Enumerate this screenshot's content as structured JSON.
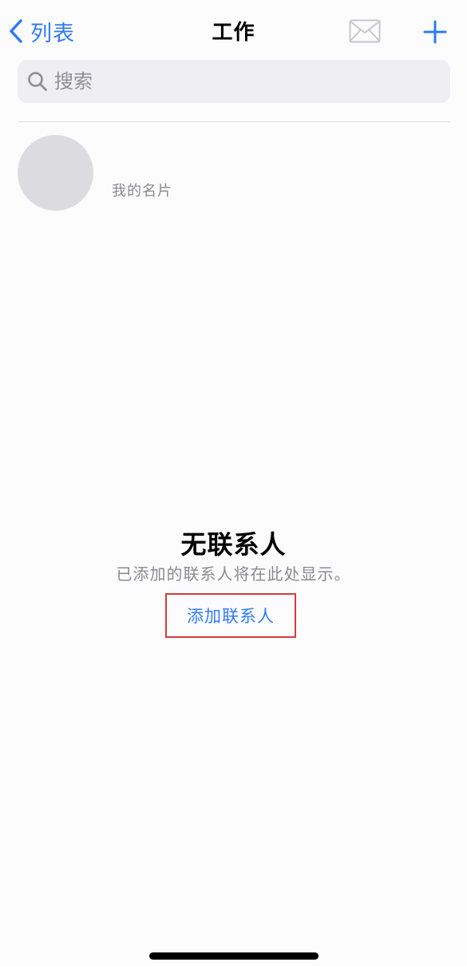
{
  "nav": {
    "back_label": "列表",
    "title": "工作",
    "back_icon": "chevron-left-icon",
    "mail_icon": "envelope-icon",
    "add_icon": "plus-icon"
  },
  "search": {
    "placeholder": "搜索",
    "icon": "magnifying-glass-icon"
  },
  "my_card": {
    "label": "我的名片"
  },
  "empty_state": {
    "title": "无联系人",
    "subtitle": "已添加的联系人将在此处显示。",
    "add_label": "添加联系人"
  },
  "colors": {
    "accent": "#2f7bf5",
    "highlight_border": "#d33c3c",
    "search_bg": "#efeef3",
    "avatar": "#dcdbdf"
  }
}
